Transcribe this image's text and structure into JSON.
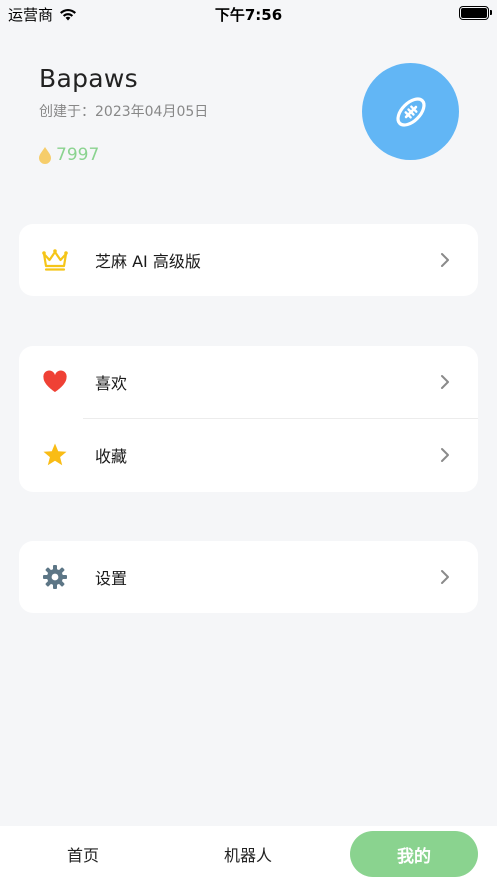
{
  "status_bar": {
    "carrier": "运营商",
    "time": "下午7:56",
    "icons": [
      "wifi-icon",
      "battery-icon"
    ]
  },
  "profile": {
    "username": "Bapaws",
    "created": "创建于：2023年04月05日",
    "coins": "7997",
    "avatar_icon": "football-icon",
    "avatar_color": "#62b6f5",
    "coin_color": "#8ad38f"
  },
  "menu": {
    "premium": {
      "label": "芝麻 AI 高级版",
      "icon": "crown-icon"
    },
    "likes": {
      "label": "喜欢",
      "icon": "heart-icon"
    },
    "favorites": {
      "label": "收藏",
      "icon": "star-icon"
    },
    "settings": {
      "label": "设置",
      "icon": "gear-icon"
    }
  },
  "tabbar": {
    "tabs": [
      {
        "label": "首页",
        "active": false
      },
      {
        "label": "机器人",
        "active": false
      },
      {
        "label": "我的",
        "active": true
      }
    ],
    "active_color": "#8ad38f"
  }
}
